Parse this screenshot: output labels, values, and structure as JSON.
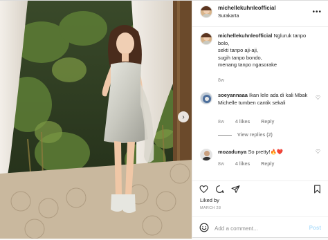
{
  "post": {
    "username": "michellekuhnleofficial",
    "location": "Surakarta",
    "options_icon": "more-horizontal-icon",
    "next_icon": "chevron-right-icon"
  },
  "caption": {
    "username": "michellekuhnleofficial",
    "lines": [
      "Ngluruk tanpo",
      "bolo,",
      "sekti tanpo aji-aji,",
      "sugih tanpo bondo,",
      "menang tanpo ngasorake"
    ],
    "time": "8w"
  },
  "comments": [
    {
      "username": "soeyannaaa",
      "text": "Ikan lele ada di kali Mbak Michelle tumben cantik sekali",
      "time": "8w",
      "likes": "4 likes",
      "reply": "Reply",
      "view_replies": "View replies (2)"
    },
    {
      "username": "mozadunya",
      "text": "So pretty!🔥❤️",
      "time": "8w",
      "likes": "4 likes",
      "reply": "Reply"
    }
  ],
  "actions": {
    "icons": [
      "heart-icon",
      "comment-icon",
      "share-icon",
      "bookmark-icon"
    ]
  },
  "likes_label": "Liked by",
  "date": "MARCH 28",
  "add_comment": {
    "placeholder": "Add a comment...",
    "post_label": "Post"
  },
  "colors": {
    "text": "#262626",
    "muted": "#8e8e8e",
    "post_button": "#b2dffc",
    "border": "#dbdbdb"
  }
}
